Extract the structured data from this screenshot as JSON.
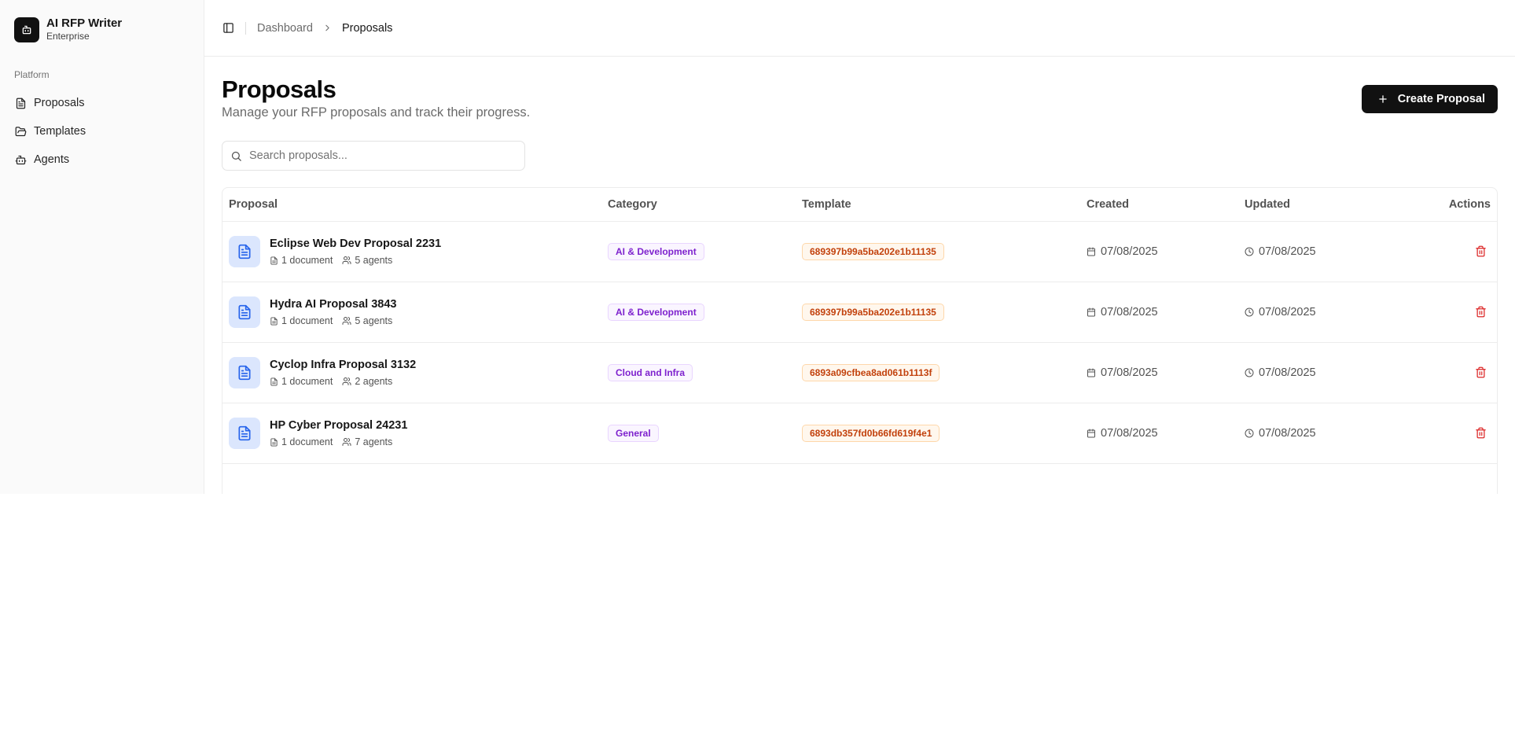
{
  "app": {
    "name": "AI RFP Writer",
    "plan": "Enterprise"
  },
  "sidebar": {
    "group_label": "Platform",
    "items": [
      {
        "label": "Proposals",
        "icon": "file-text-icon"
      },
      {
        "label": "Templates",
        "icon": "folder-open-icon"
      },
      {
        "label": "Agents",
        "icon": "bot-icon"
      }
    ]
  },
  "breadcrumb": {
    "parent": "Dashboard",
    "current": "Proposals"
  },
  "header": {
    "title": "Proposals",
    "subtitle": "Manage your RFP proposals and track their progress.",
    "create_label": "Create Proposal"
  },
  "search": {
    "placeholder": "Search proposals..."
  },
  "table": {
    "columns": [
      "Proposal",
      "Category",
      "Template",
      "Created",
      "Updated",
      "Actions"
    ],
    "rows": [
      {
        "name": "Eclipse Web Dev Proposal 2231",
        "documents": "1 document",
        "agents": "5 agents",
        "category": "AI & Development",
        "template": "689397b99a5ba202e1b11135",
        "created": "07/08/2025",
        "updated": "07/08/2025"
      },
      {
        "name": "Hydra AI Proposal 3843",
        "documents": "1 document",
        "agents": "5 agents",
        "category": "AI & Development",
        "template": "689397b99a5ba202e1b11135",
        "created": "07/08/2025",
        "updated": "07/08/2025"
      },
      {
        "name": "Cyclop Infra Proposal 3132",
        "documents": "1 document",
        "agents": "2 agents",
        "category": "Cloud and Infra",
        "template": "6893a09cfbea8ad061b1113f",
        "created": "07/08/2025",
        "updated": "07/08/2025"
      },
      {
        "name": "HP Cyber Proposal 24231",
        "documents": "1 document",
        "agents": "7 agents",
        "category": "General",
        "template": "6893db357fd0b66fd619f4e1",
        "created": "07/08/2025",
        "updated": "07/08/2025"
      }
    ]
  },
  "colors": {
    "primary": "#111111",
    "category_text": "#7e22ce",
    "template_text": "#c2410c",
    "danger": "#dc2626",
    "proposal_icon_bg": "#dbe6fd"
  }
}
